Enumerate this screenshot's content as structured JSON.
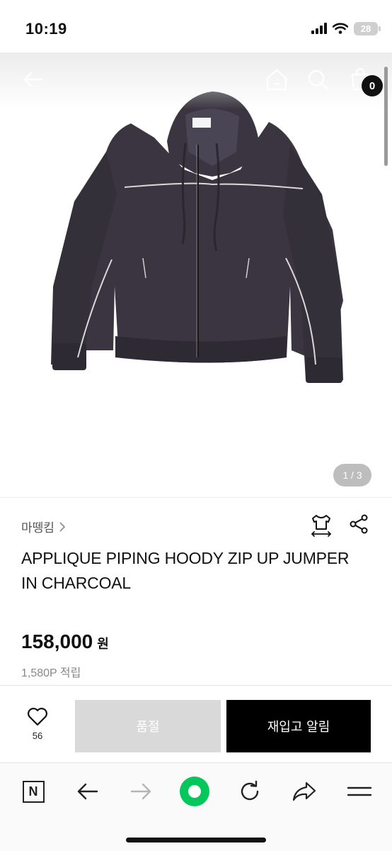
{
  "status_bar": {
    "time": "10:19",
    "battery": "28"
  },
  "header": {
    "cart_count": "0"
  },
  "gallery": {
    "indicator": "1 / 3"
  },
  "product": {
    "brand": "마뗑킴",
    "title": "APPLIQUE PIPING HOODY ZIP UP JUMPER IN CHARCOAL",
    "price": "158,000",
    "currency": "원",
    "points": "1,580P 적립"
  },
  "purchase": {
    "like_count": "56",
    "soldout_label": "품절",
    "restock_label": "재입고 알림"
  },
  "browser": {
    "home_label": "N"
  },
  "colors": {
    "accent_green": "#03c75a",
    "product_charcoal": "#3a3540"
  },
  "icons": [
    "back-arrow-icon",
    "home-icon",
    "search-icon",
    "cart-icon",
    "size-guide-icon",
    "share-icon",
    "heart-icon",
    "naver-home-icon",
    "refresh-icon",
    "menu-icon"
  ]
}
